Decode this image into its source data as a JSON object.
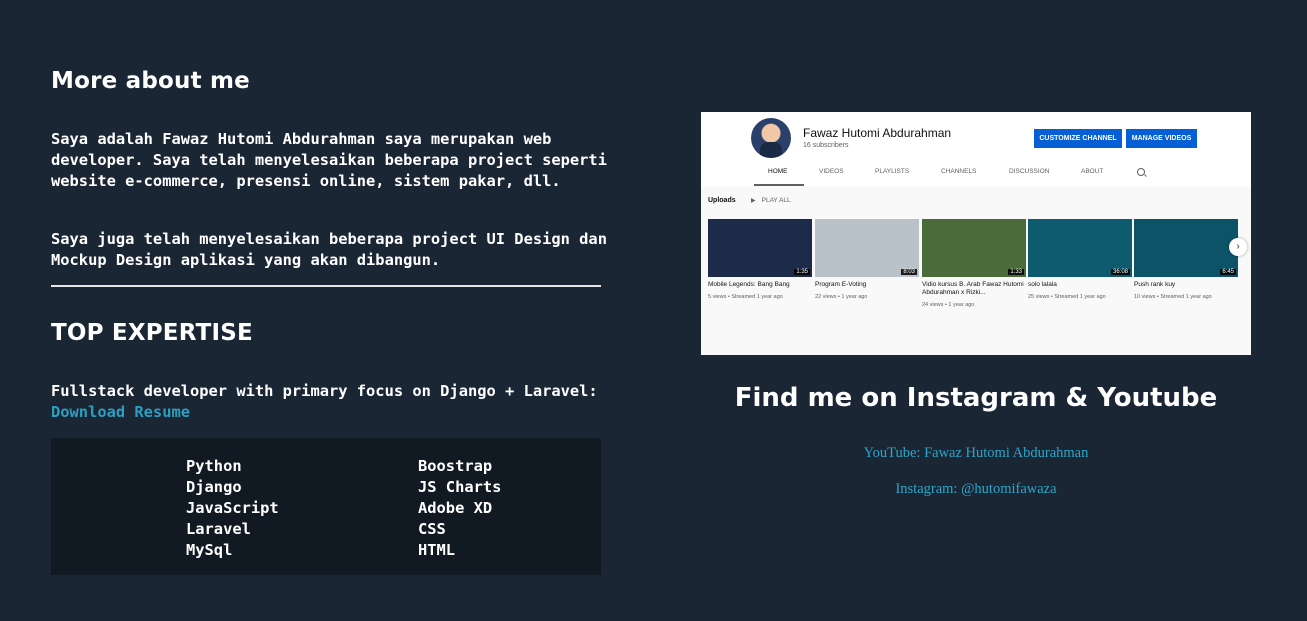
{
  "about": {
    "title": "More about me",
    "paragraph1": "Saya adalah Fawaz Hutomi Abdurahman saya merupakan web developer. Saya telah menyelesaikan beberapa project seperti website e-commerce, presensi online, sistem pakar, dll.",
    "paragraph2": "Saya juga telah menyelesaikan beberapa project UI Design dan Mockup Design aplikasi yang akan dibangun."
  },
  "expertise": {
    "title": "TOP EXPERTISE",
    "text": "Fullstack developer with primary focus on Django + Laravel: ",
    "link_label": "Download Resume",
    "skills_col1": [
      "Python",
      "Django",
      "JavaScript",
      "Laravel",
      "MySql"
    ],
    "skills_col2": [
      "Boostrap",
      "JS Charts",
      "Adobe XD",
      "CSS",
      "HTML"
    ]
  },
  "youtube_screenshot": {
    "channel_name": "Fawaz Hutomi Abdurahman",
    "subscribers": "16 subscribers",
    "customize_button": "CUSTOMIZE CHANNEL",
    "manage_button": "MANAGE VIDEOS",
    "tabs": [
      "HOME",
      "VIDEOS",
      "PLAYLISTS",
      "CHANNELS",
      "DISCUSSION",
      "ABOUT"
    ],
    "active_tab": "HOME",
    "uploads_label": "Uploads",
    "play_all_label": "PLAY ALL",
    "videos": [
      {
        "title": "Mobile Legends: Bang Bang",
        "meta": "5 views • Streamed 1 year ago",
        "duration": "1:35",
        "color": "#1e2a4a"
      },
      {
        "title": "Program E-Voting",
        "meta": "22 views • 1 year ago",
        "duration": "8:03",
        "color": "#b9c2c9"
      },
      {
        "title": "Vidio kursus B. Arab Fawaz Hutomi Abdurahman x Rizki...",
        "meta": "24 views • 1 year ago",
        "duration": "1:33",
        "color": "#4b6b3a"
      },
      {
        "title": "solo lalala",
        "meta": "25 views • Streamed 1 year ago",
        "duration": "36:08",
        "color": "#0e5a6e"
      },
      {
        "title": "Push rank kuy",
        "meta": "10 views • Streamed 1 year ago",
        "duration": "6:45",
        "color": "#0d5368"
      }
    ]
  },
  "find": {
    "title": "Find me on Instagram & Youtube",
    "youtube_label": "YouTube: Fawaz Hutomi Abdurahman",
    "instagram_label": "Instagram: @hutomifawaza"
  },
  "colors": {
    "background": "#1b2635",
    "link": "#2a9fbf",
    "skills_bg": "#111a22"
  }
}
